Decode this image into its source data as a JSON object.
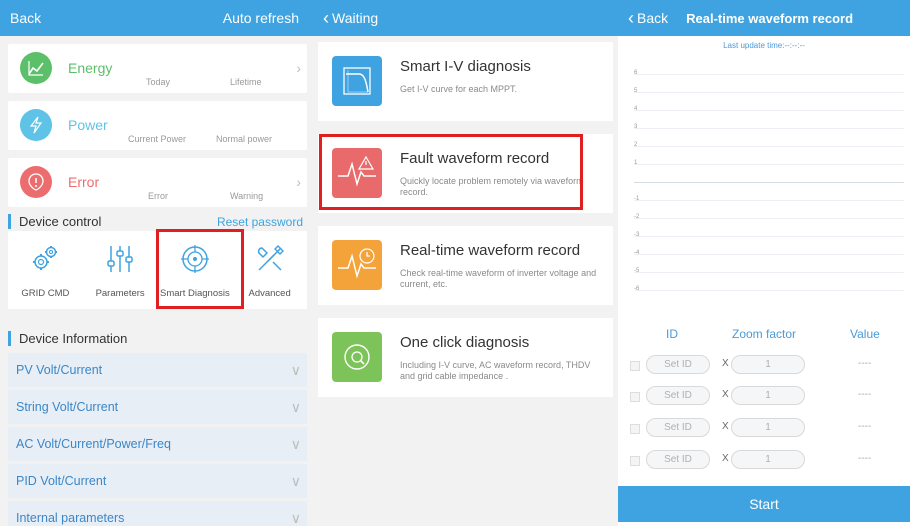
{
  "panel1": {
    "back": "Back",
    "auto_refresh": "Auto refresh",
    "energy": {
      "title": "Energy",
      "sub1": "Today",
      "sub2": "Lifetime"
    },
    "power": {
      "title": "Power",
      "sub1": "Current Power",
      "sub2": "Normal power"
    },
    "error": {
      "title": "Error",
      "sub1": "Error",
      "sub2": "Warning"
    },
    "device_control": "Device control",
    "reset_password": "Reset password",
    "controls": [
      "GRID CMD",
      "Parameters",
      "Smart Diagnosis",
      "Advanced"
    ],
    "device_information": "Device Information",
    "info_rows": [
      "PV Volt/Current",
      "String Volt/Current",
      "AC Volt/Current/Power/Freq",
      "PID Volt/Current",
      "Internal parameters"
    ],
    "colors": {
      "accent": "#3ea3e0",
      "energy": "#5cbf6a",
      "power": "#5ec3e6",
      "error": "#ec6d6d",
      "highlight": "#e02020"
    }
  },
  "panel2": {
    "back": "Waiting",
    "items": [
      {
        "title": "Smart I-V diagnosis",
        "desc": "Get I-V curve for each MPPT.",
        "icon": "iv-curve-icon",
        "color": "#3ea3e0"
      },
      {
        "title": "Fault waveform record",
        "desc": "Quickly locate problem remotely via waveform record.",
        "icon": "fault-waveform-icon",
        "color": "#e86a6a"
      },
      {
        "title": "Real-time waveform record",
        "desc": "Check real-time waveform of inverter voltage and current, etc.",
        "icon": "realtime-waveform-icon",
        "color": "#f3a33a"
      },
      {
        "title": "One click diagnosis",
        "desc": "Including I-V curve, AC waveform record, THDV and grid cable impedance .",
        "icon": "one-click-icon",
        "color": "#7cc35a"
      }
    ]
  },
  "panel3": {
    "back": "Back",
    "title": "Real-time waveform record",
    "last_update": "Last update time:--:--:--",
    "y_ticks": [
      "6",
      "5",
      "4",
      "3",
      "2",
      "1",
      "",
      "-1",
      "-2",
      "-3",
      "-4",
      "-5",
      "-6"
    ],
    "col_id": "ID",
    "col_zoom": "Zoom factor",
    "col_value": "Value",
    "rows": [
      {
        "id": "Set ID",
        "x": "X",
        "zoom": "1",
        "value": "----"
      },
      {
        "id": "Set ID",
        "x": "X",
        "zoom": "1",
        "value": "----"
      },
      {
        "id": "Set ID",
        "x": "X",
        "zoom": "1",
        "value": "----"
      },
      {
        "id": "Set ID",
        "x": "X",
        "zoom": "1",
        "value": "----"
      }
    ],
    "start": "Start"
  }
}
